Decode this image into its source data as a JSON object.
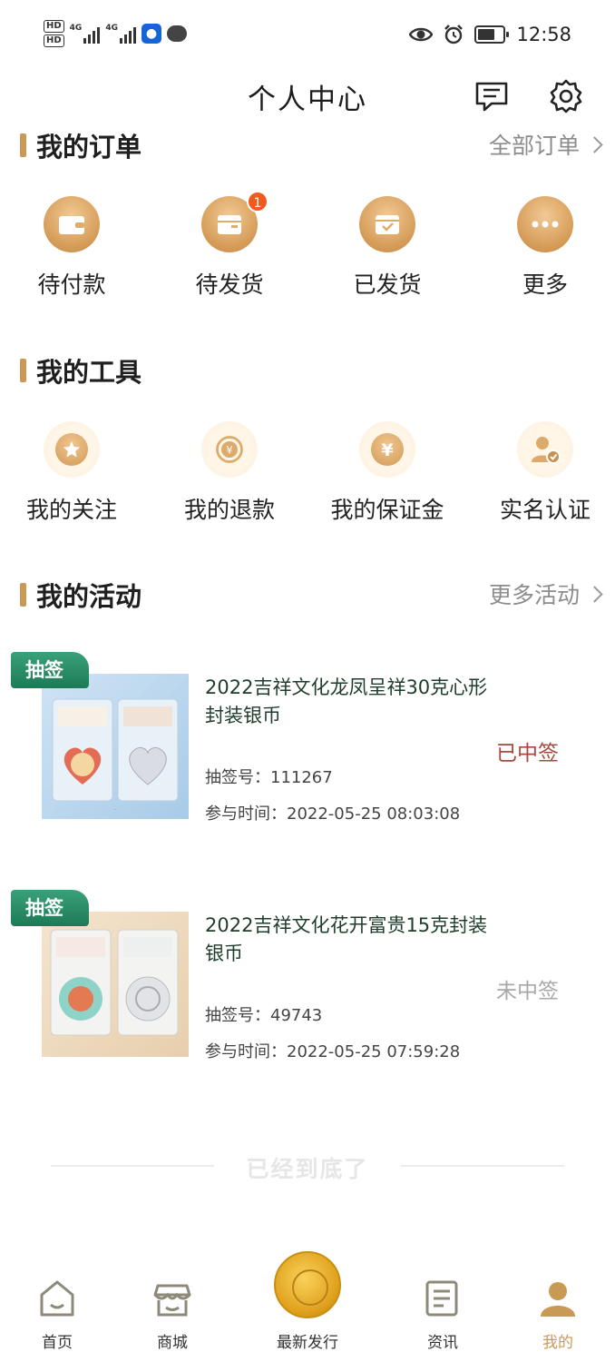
{
  "status_bar": {
    "hd1": "HD",
    "hd2": "HD",
    "net1": "4G",
    "net2": "4G",
    "time": "12:58"
  },
  "header": {
    "title": "个人中心"
  },
  "orders": {
    "title": "我的订单",
    "more_label": "全部订单",
    "items": [
      {
        "label": "待付款",
        "icon": "wallet-icon"
      },
      {
        "label": "待发货",
        "icon": "box-icon",
        "badge": "1"
      },
      {
        "label": "已发货",
        "icon": "shipped-box-icon"
      },
      {
        "label": "更多",
        "icon": "more-dots-icon"
      }
    ]
  },
  "tools": {
    "title": "我的工具",
    "items": [
      {
        "label": "我的关注",
        "icon": "star-icon"
      },
      {
        "label": "我的退款",
        "icon": "refund-icon"
      },
      {
        "label": "我的保证金",
        "icon": "deposit-icon"
      },
      {
        "label": "实名认证",
        "icon": "verify-user-icon"
      }
    ]
  },
  "activities": {
    "title": "我的活动",
    "more_label": "更多活动",
    "items": [
      {
        "tag": "抽签",
        "title": "2022吉祥文化龙凤呈祥30克心形封装银币",
        "number_label": "抽签号：",
        "number": "111267",
        "time_label": "参与时间：",
        "time": "2022-05-25 08:03:08",
        "status": "已中签",
        "status_color": "#a9483c"
      },
      {
        "tag": "抽签",
        "title": "2022吉祥文化花开富贵15克封装银币",
        "number_label": "抽签号：",
        "number": "49743",
        "time_label": "参与时间：",
        "time": "2022-05-25 07:59:28",
        "status": "未中签",
        "status_color": "#a8a8a8"
      }
    ]
  },
  "end_text": "已经到底了",
  "bottom_nav": {
    "items": [
      {
        "label": "首页",
        "icon": "home-icon"
      },
      {
        "label": "商城",
        "icon": "store-icon"
      },
      {
        "label": "最新发行",
        "icon": "coin-icon"
      },
      {
        "label": "资讯",
        "icon": "news-icon"
      },
      {
        "label": "我的",
        "icon": "profile-icon",
        "active": true
      }
    ],
    "active_color": "#c89a55"
  }
}
